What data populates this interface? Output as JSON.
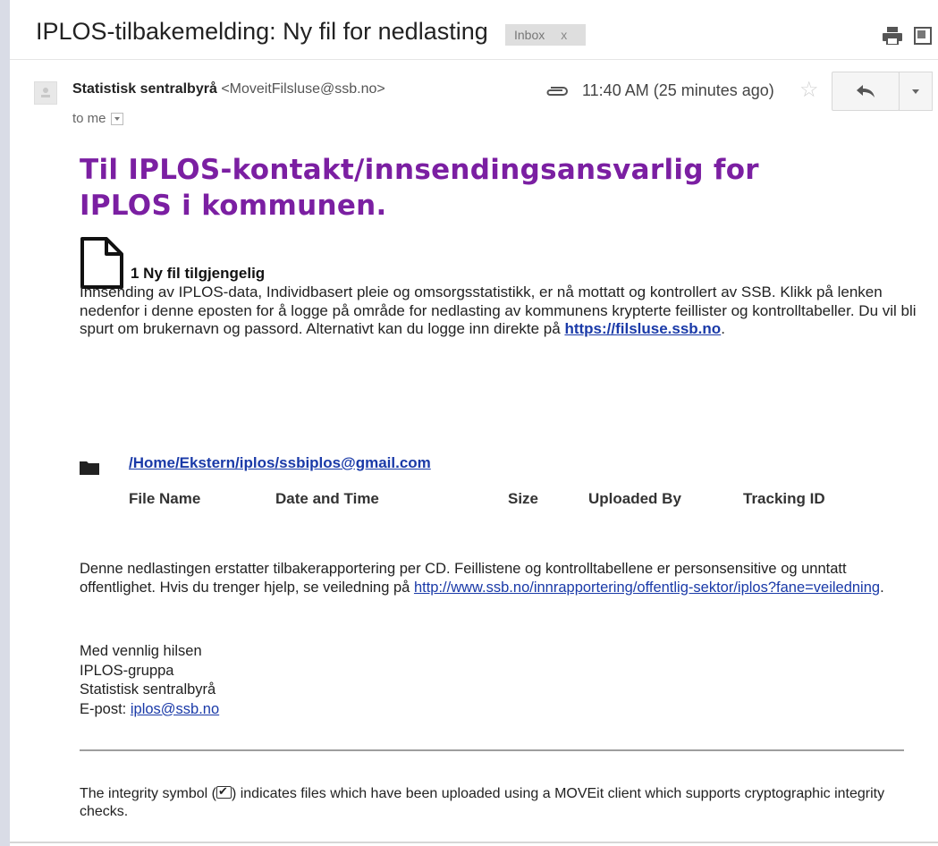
{
  "email": {
    "subject": "IPLOS-tilbakemelding: Ny fil for nedlasting",
    "label": "Inbox",
    "label_close": "x",
    "sender_name": "Statistisk sentralbyrå",
    "sender_email": "<MoveitFilsluse@ssb.no>",
    "recipient": "to me",
    "time": "11:40 AM (25 minutes ago)"
  },
  "body": {
    "heading": "Til IPLOS-kontakt/innsendingsansvarlig for IPLOS i kommunen.",
    "files_available": "1 Ny fil tilgjengelig",
    "intro_text": "Innsending av IPLOS-data, Individbasert pleie og omsorgsstatistikk, er nå mottatt og kontrollert av SSB. Klikk på lenken nedenfor i denne eposten for å logge på område for nedlasting av kommunens krypterte feillister og kontrolltabeller. Du vil bli spurt om brukernavn og passord. Alternativt kan du logge inn direkte på ",
    "intro_link": "https://filsluse.ssb.no",
    "intro_end": ".",
    "folder_path": "/Home/Ekstern/iplos/ssbiplos@gmail.com",
    "columns": [
      "File Name",
      "Date and Time",
      "Size",
      "Uploaded By",
      "Tracking ID"
    ],
    "notice_text": "Denne nedlastingen erstatter tilbakerapportering per CD. Feillistene og kontrolltabellene er personsensitive og unntatt offentlighet. Hvis du trenger hjelp, se veiledning på ",
    "notice_link": "http://www.ssb.no/innrapportering/offentlig-sektor/iplos?fane=veiledning",
    "notice_end": ".",
    "signoff": {
      "greeting": "Med vennlig hilsen",
      "team": "IPLOS-gruppa",
      "org": "Statistisk sentralbyrå",
      "email_label": "E-post: ",
      "email": "iplos@ssb.no"
    },
    "footnote_before": "The integrity symbol (",
    "footnote_after": ") indicates files which have been uploaded using a MOVEit client which supports cryptographic integrity checks."
  },
  "icons": [
    "print-icon",
    "new-window-icon",
    "avatar-icon",
    "attachment-icon",
    "star-icon",
    "reply-icon",
    "more-icon",
    "document-icon",
    "folder-icon",
    "integrity-check-icon"
  ]
}
